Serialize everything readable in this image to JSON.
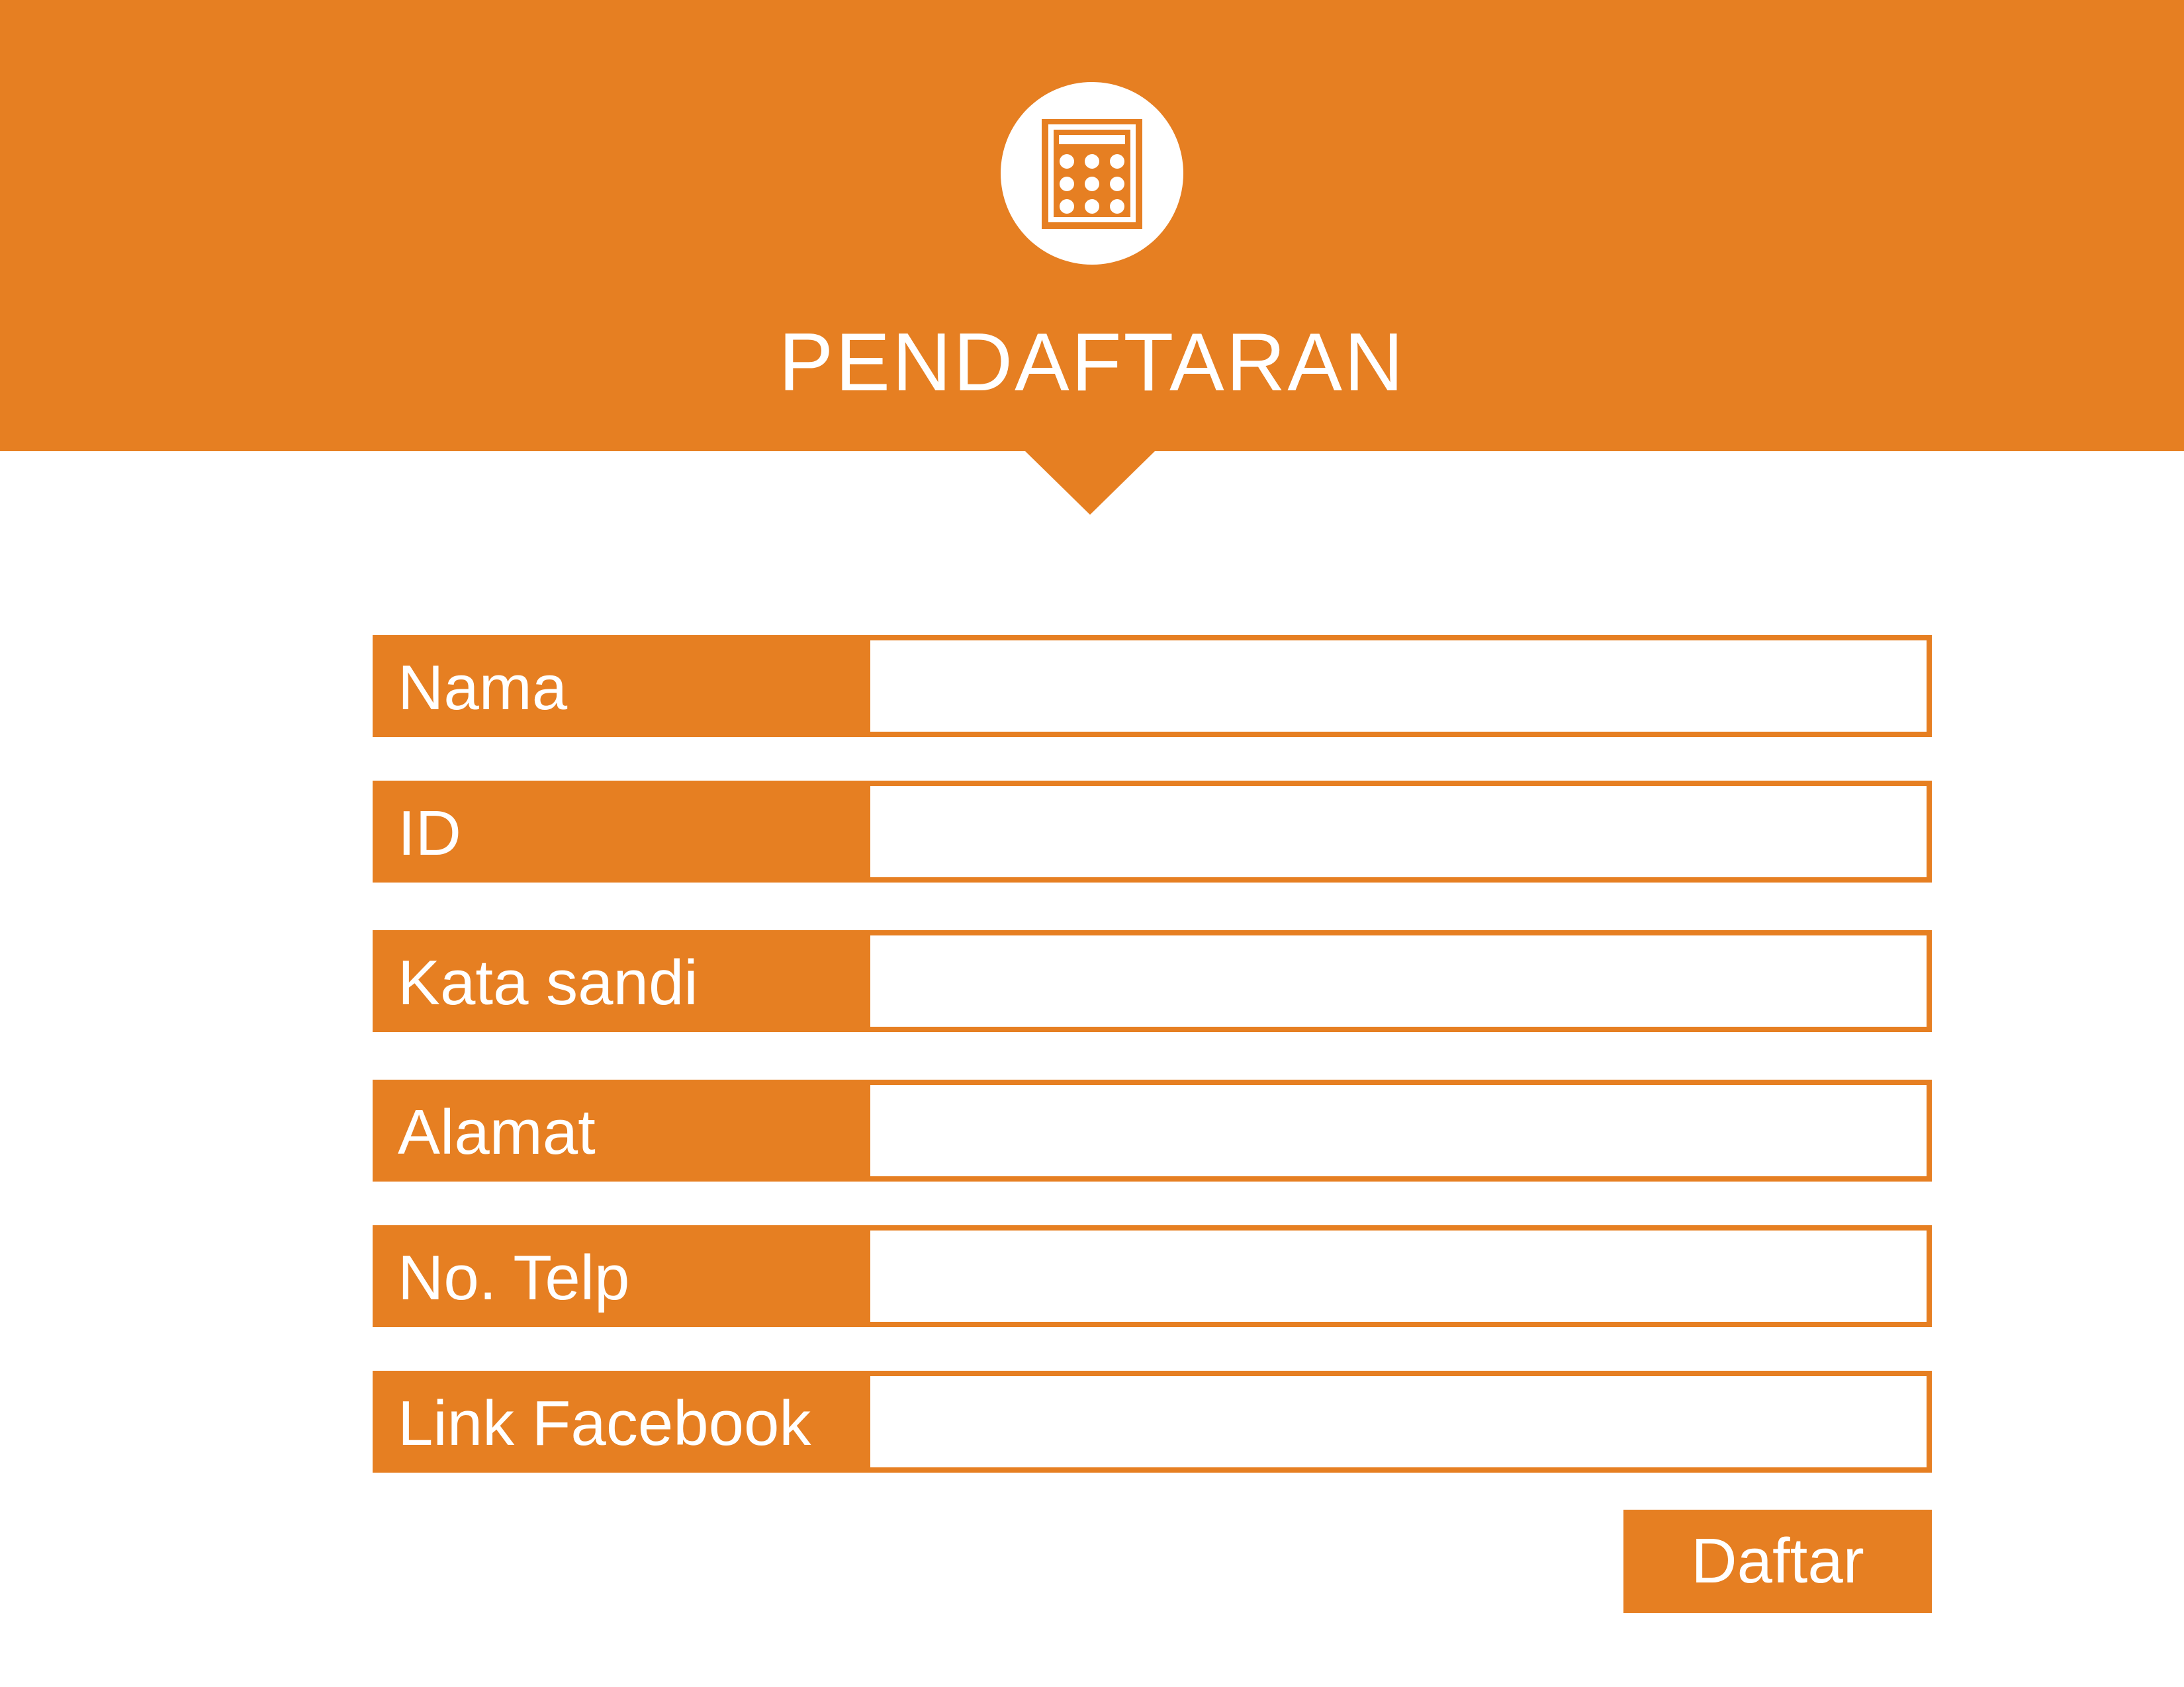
{
  "header": {
    "title": "PENDAFTARAN",
    "icon": "calculator-icon",
    "background_color": "#E67F22"
  },
  "form": {
    "fields": [
      {
        "label": "Nama",
        "value": "",
        "placeholder": ""
      },
      {
        "label": "ID",
        "value": "",
        "placeholder": ""
      },
      {
        "label": "Kata sandi",
        "value": "",
        "placeholder": ""
      },
      {
        "label": "Alamat",
        "value": "",
        "placeholder": ""
      },
      {
        "label": "No. Telp",
        "value": "",
        "placeholder": ""
      },
      {
        "label": "Link Facebook",
        "value": "",
        "placeholder": ""
      }
    ],
    "submit_label": "Daftar"
  },
  "colors": {
    "accent": "#E67F22",
    "text_on_accent": "#FFFFFF",
    "background": "#FFFFFF"
  }
}
